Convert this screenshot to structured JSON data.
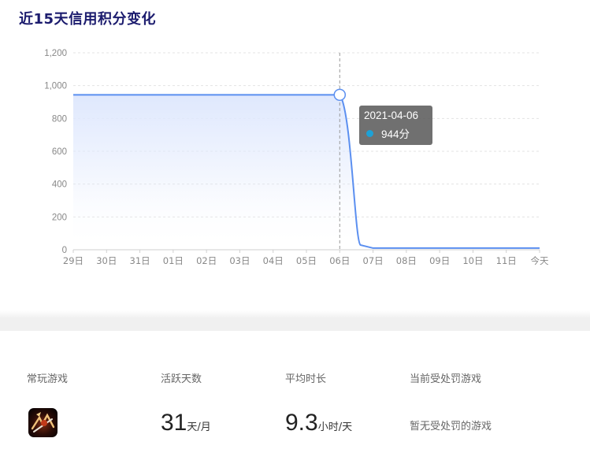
{
  "header": {
    "title": "近15天信用积分变化"
  },
  "chart_data": {
    "type": "area",
    "categories": [
      "29日",
      "30日",
      "31日",
      "01日",
      "02日",
      "03日",
      "04日",
      "05日",
      "06日",
      "07日",
      "08日",
      "09日",
      "10日",
      "11日",
      "今天"
    ],
    "values": [
      944,
      944,
      944,
      944,
      944,
      944,
      944,
      944,
      944,
      10,
      10,
      10,
      10,
      10,
      10
    ],
    "ylim": [
      0,
      1200
    ],
    "yticks": [
      0,
      200,
      400,
      600,
      800,
      1000,
      1200
    ],
    "ytick_labels": [
      "0",
      "200",
      "400",
      "600",
      "800",
      "1,000",
      "1,200"
    ],
    "grid": true,
    "line_color": "#5b8ff0",
    "fill_color": "#dfe8fd",
    "tooltip": {
      "category_index": 8,
      "date": "2021-04-06",
      "value_label": "944分",
      "dot_color": "#1da1d6"
    }
  },
  "stats": {
    "game": {
      "label": "常玩游戏",
      "icon": "game-app-icon"
    },
    "active_days": {
      "label": "活跃天数",
      "value": "31",
      "unit": "天/月"
    },
    "avg_time": {
      "label": "平均时长",
      "value": "9.3",
      "unit": "小时/天"
    },
    "penalty": {
      "label": "当前受处罚游戏",
      "value": "暂无受处罚的游戏"
    }
  }
}
